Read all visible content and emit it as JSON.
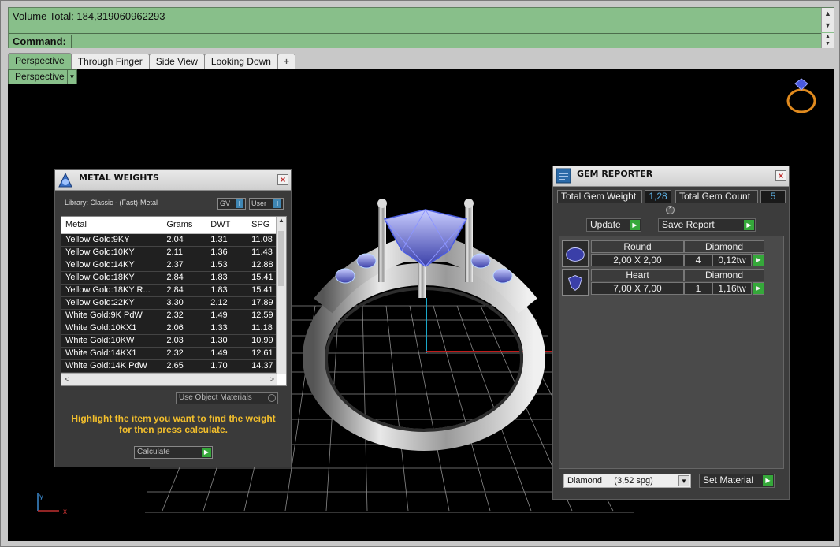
{
  "command": {
    "volume_text": "Volume Total: 184,319060962293",
    "command_label": "Command:",
    "command_value": ""
  },
  "tabs": [
    {
      "label": "Perspective",
      "active": true
    },
    {
      "label": "Through Finger",
      "active": false
    },
    {
      "label": "Side View",
      "active": false
    },
    {
      "label": "Looking Down",
      "active": false
    },
    {
      "label": "+",
      "active": false
    }
  ],
  "viewport": {
    "selector_label": "Perspective",
    "axis_x": "x",
    "axis_y": "y"
  },
  "metal_weights": {
    "title": "METAL WEIGHTS",
    "library": "Library: Classic - (Fast)-Metal",
    "toggle_gv": "GV",
    "toggle_user": "User",
    "columns": [
      "Metal",
      "Grams",
      "DWT",
      "SPG"
    ],
    "rows": [
      [
        "Yellow Gold:9KY",
        "2.04",
        "1.31",
        "11.08"
      ],
      [
        "Yellow Gold:10KY",
        "2.11",
        "1.36",
        "11.43"
      ],
      [
        "Yellow Gold:14KY",
        "2.37",
        "1.53",
        "12.88"
      ],
      [
        "Yellow Gold:18KY",
        "2.84",
        "1.83",
        "15.41"
      ],
      [
        "Yellow Gold:18KY R...",
        "2.84",
        "1.83",
        "15.41"
      ],
      [
        "Yellow Gold:22KY",
        "3.30",
        "2.12",
        "17.89"
      ],
      [
        "White Gold:9K PdW",
        "2.32",
        "1.49",
        "12.59"
      ],
      [
        "White Gold:10KX1",
        "2.06",
        "1.33",
        "11.18"
      ],
      [
        "White Gold:10KW",
        "2.03",
        "1.30",
        "10.99"
      ],
      [
        "White Gold:14KX1",
        "2.32",
        "1.49",
        "12.61"
      ],
      [
        "White Gold:14K PdW",
        "2.65",
        "1.70",
        "14.37"
      ]
    ],
    "use_object_materials": "Use Object Materials",
    "hint": "Highlight the item you want to find the weight for then press calculate.",
    "calculate_label": "Calculate"
  },
  "gem_reporter": {
    "title": "GEM REPORTER",
    "total_weight_label": "Total Gem Weight",
    "total_weight_value": "1,28",
    "total_count_label": "Total Gem Count",
    "total_count_value": "5",
    "update_label": "Update",
    "save_report_label": "Save Report",
    "gems": [
      {
        "shape": "Round",
        "material": "Diamond",
        "size": "2,00 X 2,00",
        "count": "4",
        "weight": "0,12tw"
      },
      {
        "shape": "Heart",
        "material": "Diamond",
        "size": "7,00 X 7,00",
        "count": "1",
        "weight": "1,16tw"
      }
    ],
    "material_select": "Diamond     (3,52 spg)",
    "set_material_label": "Set Material"
  }
}
